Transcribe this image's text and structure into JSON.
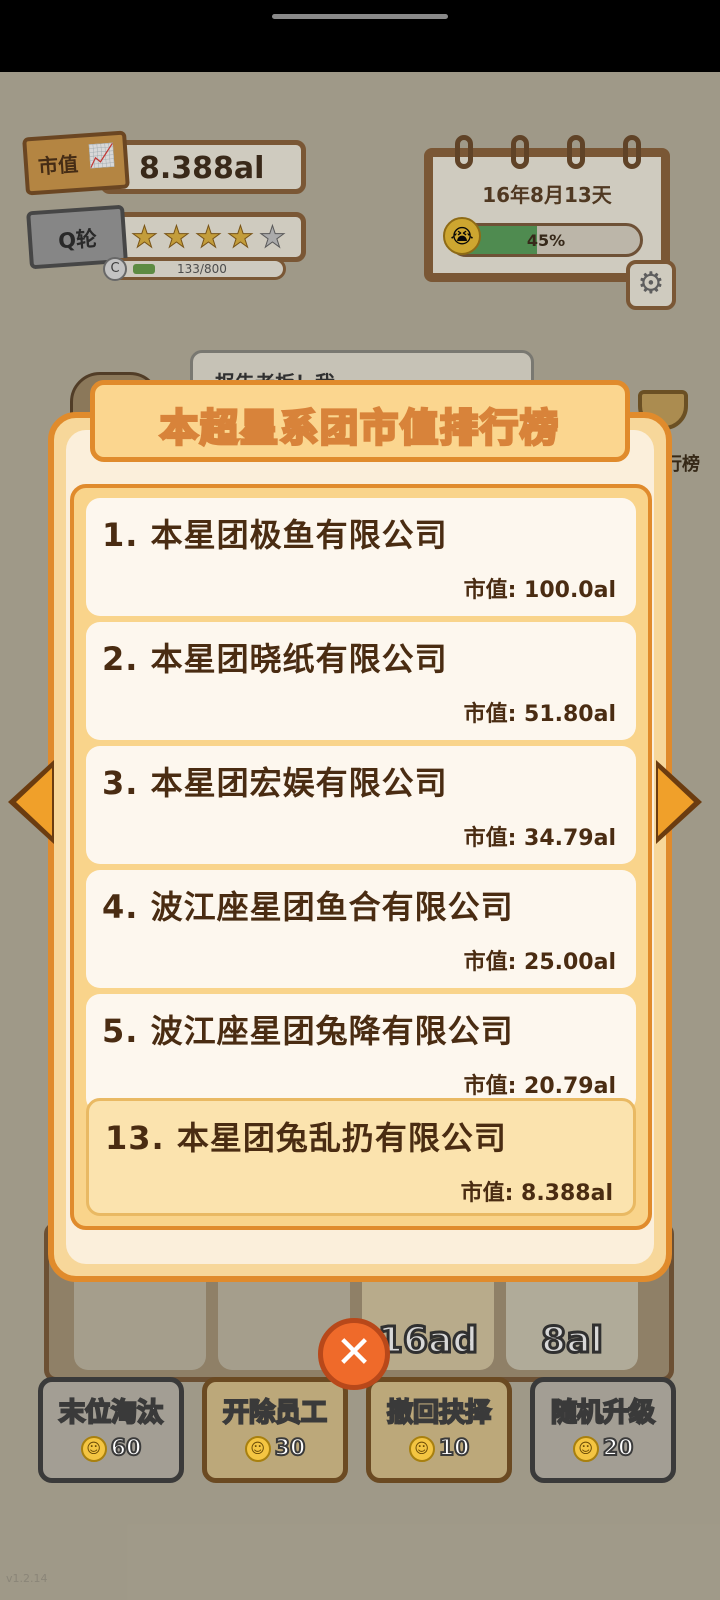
{
  "hud": {
    "value_tag_label": "市值",
    "market_value": "8.388al",
    "rank_tag_label": "Q轮",
    "stars_filled": 4,
    "stars_total": 5,
    "xp_grade": "C",
    "xp_text": "133/800",
    "xp_progress": 0.166
  },
  "calendar": {
    "date": "16年8月13天",
    "percent_text": "45%",
    "progress": 0.45
  },
  "background": {
    "bubble_text": "报告老板！我",
    "trophy_label": "行榜",
    "cards": [
      "16ad",
      "8al"
    ]
  },
  "modal": {
    "title": "本超星系团市值排行榜",
    "value_prefix": "市值: ",
    "entries": [
      {
        "name": "1. 本星团极鱼有限公司",
        "value": "市值: 100.0al"
      },
      {
        "name": "2. 本星团晓纸有限公司",
        "value": "市值: 51.80al"
      },
      {
        "name": "3. 本星团宏娱有限公司",
        "value": "市值: 34.79al"
      },
      {
        "name": "4. 波江座星团鱼合有限公司",
        "value": "市值: 25.00al"
      },
      {
        "name": "5. 波江座星团兔降有限公司",
        "value": "市值: 20.79al"
      }
    ],
    "self_entry": {
      "name": "13. 本星团兔乱扔有限公司",
      "value": "市值: 8.388al"
    }
  },
  "actions": [
    {
      "label": "末位淘汰",
      "cost": "60"
    },
    {
      "label": "开除员工",
      "cost": "30"
    },
    {
      "label": "撤回抉择",
      "cost": "10"
    },
    {
      "label": "随机升级",
      "cost": "20"
    }
  ],
  "version": "v1.2.14",
  "colors": {
    "modal_border": "#e08b2c",
    "modal_fill": "#f7d79a",
    "text_brown": "#4a2c12",
    "close_button": "#ef6a2a"
  }
}
